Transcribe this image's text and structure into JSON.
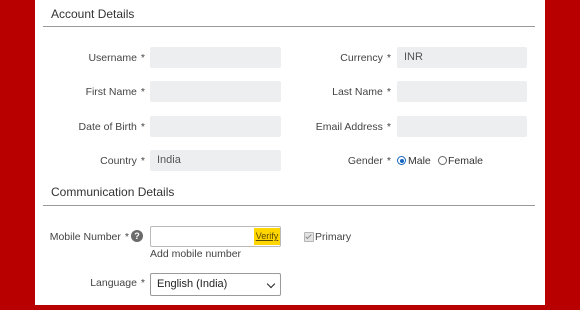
{
  "account_section": {
    "title": "Account Details"
  },
  "fields": {
    "username": {
      "label": "Username",
      "value": ""
    },
    "currency": {
      "label": "Currency",
      "value": "INR"
    },
    "first_name": {
      "label": "First Name",
      "value": ""
    },
    "last_name": {
      "label": "Last Name",
      "value": ""
    },
    "dob": {
      "label": "Date of Birth",
      "value": ""
    },
    "email": {
      "label": "Email Address",
      "value": ""
    },
    "country": {
      "label": "Country",
      "value": "India"
    },
    "gender": {
      "label": "Gender",
      "options": [
        "Male",
        "Female"
      ],
      "selected": "Male"
    }
  },
  "required_marker": "*",
  "communication_section": {
    "title": "Communication Details"
  },
  "mobile": {
    "label": "Mobile Number",
    "help_glyph": "?",
    "value": "",
    "verify_label": "Verify",
    "primary_label": "Primary",
    "add_label": "Add mobile number"
  },
  "language": {
    "label": "Language",
    "selected": "English (India)"
  },
  "colors": {
    "background": "#b80000",
    "verify_highlight": "#ffd600",
    "radio_accent": "#1565c0"
  }
}
